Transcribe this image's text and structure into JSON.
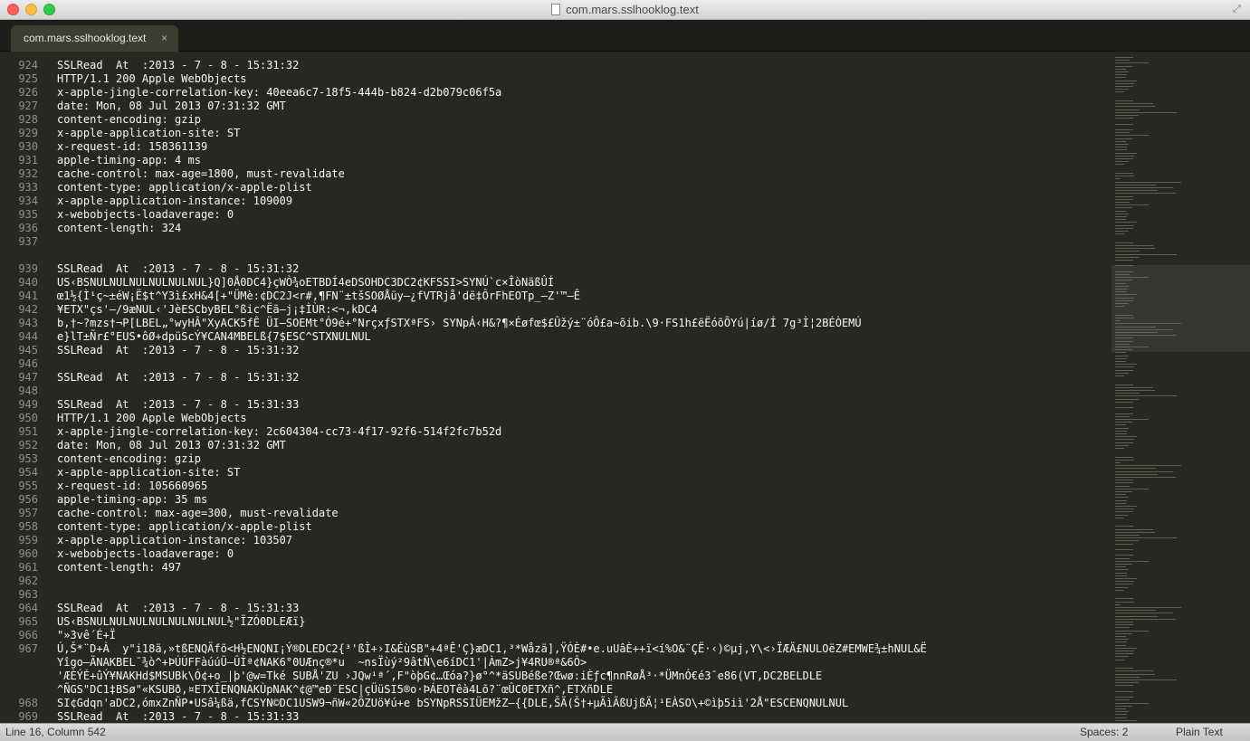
{
  "window": {
    "title": "com.mars.sslhooklog.text"
  },
  "tab": {
    "label": "com.mars.sslhooklog.text",
    "close": "×"
  },
  "editor": {
    "lines": [
      {
        "n": "924",
        "t": "SSLRead  At  :2013 - 7 - 8 - 15:31:32"
      },
      {
        "n": "925",
        "t": "HTTP/1.1 200 Apple WebObjects"
      },
      {
        "n": "926",
        "t": "x-apple-jingle-correlation-key: 40eea6c7-18f5-444b-b824-d2b079c06f5a"
      },
      {
        "n": "927",
        "t": "date: Mon, 08 Jul 2013 07:31:32 GMT"
      },
      {
        "n": "928",
        "t": "content-encoding: gzip"
      },
      {
        "n": "929",
        "t": "x-apple-application-site: ST"
      },
      {
        "n": "930",
        "t": "x-request-id: 158361139"
      },
      {
        "n": "931",
        "t": "apple-timing-app: 4 ms"
      },
      {
        "n": "932",
        "t": "cache-control: max-age=1800, must-revalidate"
      },
      {
        "n": "933",
        "t": "content-type: application/x-apple-plist"
      },
      {
        "n": "934",
        "t": "x-apple-application-instance: 109009"
      },
      {
        "n": "935",
        "t": "x-webobjects-loadaverage: 0"
      },
      {
        "n": "936",
        "t": "content-length: 324"
      },
      {
        "n": "937",
        "t": ""
      },
      {
        "n": "",
        "t": ""
      },
      {
        "n": "939",
        "t": "SSLRead  At  :2013 - 7 - 8 - 15:31:32"
      },
      {
        "n": "940",
        "t": "US‹BSNULNULNULNULNULNUL}Q]0Å0DC4}çWÒ¾oETBDÍ4eDSOHDC3DC2¢KFSSI>SYNÚ`c×ÎòNäßÛÍ"
      },
      {
        "n": "941",
        "t": "œ1½{Ì¹ç~±éW¡Ë$t^Y3ì£xH&4[+\"ÜMè:¢DC2J<r#,¶FN¨±tšSOØÅüy–¿fVTRjå'dë‡ÔrFhEOTp_–Z'™–Ê"
      },
      {
        "n": "942",
        "t": "¥ETX\"çs'–/9æNUL‹'JèESCbyBEL°ßic^Ëã–j¡‡ÌÙR:<¬,kDC4"
      },
      {
        "n": "943",
        "t": "b,†~?mzs†¬P[LBEL„°wyHÂ\"XyACK5fÊ ÜI–SOEMt°Ó9é+°NrçxƒSTXªFS› SYNpÁ‹H&?¶×Éøfœ$£Ûžý±¨óÔ£a~õib.\\9·FS1h£ëËóõÕYú|íø/Í 7g³Ì¦2BÉÒEMÚ"
      },
      {
        "n": "944",
        "t": "e}lT±Ñr£°EUS•ôØ+dpüScÝ¥CAN4MBELß{7$ESC^STXNULNUL"
      },
      {
        "n": "945",
        "t": "SSLRead  At  :2013 - 7 - 8 - 15:31:32"
      },
      {
        "n": "946",
        "t": ""
      },
      {
        "n": "947",
        "t": "SSLRead  At  :2013 - 7 - 8 - 15:31:32"
      },
      {
        "n": "948",
        "t": ""
      },
      {
        "n": "949",
        "t": "SSLRead  At  :2013 - 7 - 8 - 15:31:33"
      },
      {
        "n": "950",
        "t": "HTTP/1.1 200 Apple WebObjects"
      },
      {
        "n": "951",
        "t": "x-apple-jingle-correlation-key: 2c604304-cc73-4f17-92f6-514f2fc7b52d"
      },
      {
        "n": "952",
        "t": "date: Mon, 08 Jul 2013 07:31:32 GMT"
      },
      {
        "n": "953",
        "t": "content-encoding: gzip"
      },
      {
        "n": "954",
        "t": "x-apple-application-site: ST"
      },
      {
        "n": "955",
        "t": "x-request-id: 105660965"
      },
      {
        "n": "956",
        "t": "apple-timing-app: 35 ms"
      },
      {
        "n": "957",
        "t": "cache-control: max-age=300, must-revalidate"
      },
      {
        "n": "958",
        "t": "content-type: application/x-apple-plist"
      },
      {
        "n": "959",
        "t": "x-apple-application-instance: 103507"
      },
      {
        "n": "960",
        "t": "x-webobjects-loadaverage: 0"
      },
      {
        "n": "961",
        "t": "content-length: 497"
      },
      {
        "n": "962",
        "t": ""
      },
      {
        "n": "963",
        "t": ""
      },
      {
        "n": "964",
        "t": "SSLRead  At  :2013 - 7 - 8 - 15:31:33"
      },
      {
        "n": "965",
        "t": "US‹BSNULNULNULNULNULNULNUL½\"ÏZÓ0DLEÆï}"
      },
      {
        "n": "966",
        "t": "\"»3vê´É+Ï"
      },
      {
        "n": "967",
        "t": "Ú,Š*¨D+À  y\"i18ä,»tßENQÄfõ<H½ENQNI¡Ý®DLEDC2{³'ßÌ+›I&ÉùSB\"+4ªÊ'Ç}æDC1,³*Wåzä],ŸÓÈ#•e.uUâÈ++ï<í%O&¨ÇË·‹)©µj,Y\\<›ÏÆÄ£NULOëZ#EMWE¾±hNUL&Ë"
      },
      {
        "n": "",
        "t": "Yîgo–ÄNAKBEL¯¾ò^+ÞÚÚFFàúúÜ–ÛÌª¢NAK6°0UÆnç®*u  ~nsÏùý²9âtÑ\\e6íDC1'|ÀmZ>j¥4RU®ª&6Ô>"
      },
      {
        "n": "",
        "t": "'ÆÈÝÉ+ûÝ¥NAKHd$MSUBk\\Ó¢+o_|þ'@w=Tké SUBÅ'ZU ›JQw¹ª´,F\"òþG¢…Œóa?}ø°^*äSUBéße?Œwø:iÈƒc¶nnRøÅ³·*ÜMnÓ€é3¯e86(VT,DC2BELDLE"
      },
      {
        "n": "",
        "t": "^ÑGS\"DC1‡BSø\"«KSUBð,¤ETXÎENQNAKÙpNAK^¢@™eÐ¨ESC|çÜüSI5®o·ÞÁEOTêà4Lõ?¨œÛC0ETXñ^,ETXñDLE"
      },
      {
        "n": "968",
        "t": "SI¢Gdqn'aDC2,ómxZnÑP•USâ¼ßä,fCSYN©DC1USW9¬ñW«2ÕZUö¥ú+e bSYNpRSSIÜEMžZ–{{DLE,ŠÄ(Š†+µÄìÃßUjßÄ¦¹EÀSO\\+©ìþ5iì'2Å\"ESCENQNULNUL"
      },
      {
        "n": "969",
        "t": "SSLRead  At  :2013 - 7 - 8 - 15:31:33"
      }
    ]
  },
  "status": {
    "position": "Line 16, Column 542",
    "spaces": "Spaces: 2",
    "syntax": "Plain Text"
  }
}
